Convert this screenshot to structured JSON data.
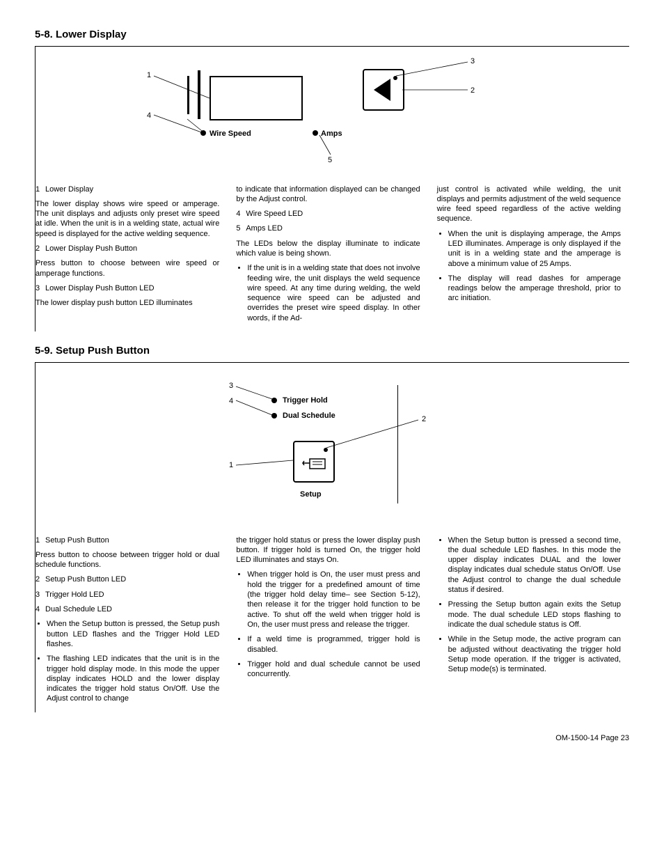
{
  "footer": "OM-1500-14 Page 23",
  "sec58": {
    "heading": "5-8.   Lower Display",
    "fig": {
      "callout1": "1",
      "callout2": "2",
      "callout3": "3",
      "callout4": "4",
      "callout5": "5",
      "wireSpeed": "Wire Speed",
      "amps": "Amps"
    },
    "col1": {
      "i1n": "1",
      "i1t": "Lower Display",
      "p1": "The lower display shows wire speed or amperage. The unit displays and adjusts only preset wire speed at idle. When the unit is in a welding state, actual wire speed is displayed for the active welding sequence.",
      "i2n": "2",
      "i2t": "Lower Display Push Button",
      "p2": "Press button to choose between wire speed or amperage functions.",
      "i3n": "3",
      "i3t": "Lower Display Push Button LED",
      "p3": "The lower display push button LED illuminates"
    },
    "col2": {
      "p1": "to indicate that information displayed can be changed by the Adjust control.",
      "i4n": "4",
      "i4t": "Wire Speed LED",
      "i5n": "5",
      "i5t": "Amps LED",
      "p2": "The LEDs below the display illuminate to indicate which value is being shown.",
      "b1": "If the unit is in a welding state that does not involve feeding wire, the unit displays the weld sequence wire speed. At any time during welding, the weld sequence wire speed can be adjusted and overrides the preset wire speed display. In other words, if the Ad-"
    },
    "col3": {
      "p1": "just control is activated while welding, the unit displays and permits adjustment of the weld sequence wire feed speed regardless of the active welding sequence.",
      "b1": "When the unit is displaying amperage, the Amps LED illuminates. Amperage is only displayed if the unit is in a welding state and the amperage is above a minimum value of 25 Amps.",
      "b2": "The display will read dashes for amperage readings below the amperage threshold, prior to arc initiation."
    }
  },
  "sec59": {
    "heading": "5-9.   Setup Push Button",
    "fig": {
      "callout1": "1",
      "callout2": "2",
      "callout3": "3",
      "callout4": "4",
      "triggerHold": "Trigger Hold",
      "dualSchedule": "Dual Schedule",
      "setup": "Setup"
    },
    "col1": {
      "i1n": "1",
      "i1t": "Setup Push Button",
      "p1": "Press button to choose between trigger hold or dual schedule functions.",
      "i2n": "2",
      "i2t": "Setup Push Button LED",
      "i3n": "3",
      "i3t": "Trigger Hold LED",
      "i4n": "4",
      "i4t": "Dual Schedule LED",
      "b1": "When the Setup button is pressed, the Setup push button LED flashes and the Trigger Hold LED flashes.",
      "b2": "The flashing LED indicates that the unit is in the trigger hold display mode. In this mode the upper display indicates HOLD and the lower display indicates the trigger hold status On/Off. Use the Adjust control to change"
    },
    "col2": {
      "p1": "the trigger hold status or press the lower display push button. If trigger hold is turned On, the trigger hold LED illuminates and stays On.",
      "b1": "When trigger hold is On, the user must press and hold the trigger for a predefined amount of time (the trigger hold delay time– see Section 5-12), then release it for the trigger hold function to be active. To shut off the weld when trigger hold is On, the user must press and release the trigger.",
      "b2": "If a weld time is programmed, trigger hold is disabled.",
      "b3": "Trigger hold and dual schedule cannot be used concurrently."
    },
    "col3": {
      "b1": "When the Setup button is pressed a second time, the dual schedule LED flashes. In this mode the upper display indicates DUAL and the lower display indicates dual schedule status On/Off. Use the Adjust control to change the dual schedule status if desired.",
      "b2": "Pressing the Setup button again exits the Setup mode. The dual schedule LED stops flashing to indicate the dual schedule status is Off.",
      "b3": "While in the Setup mode, the active program can be adjusted without deactivating the trigger hold Setup mode operation. If the trigger is activated, Setup mode(s) is terminated."
    }
  }
}
